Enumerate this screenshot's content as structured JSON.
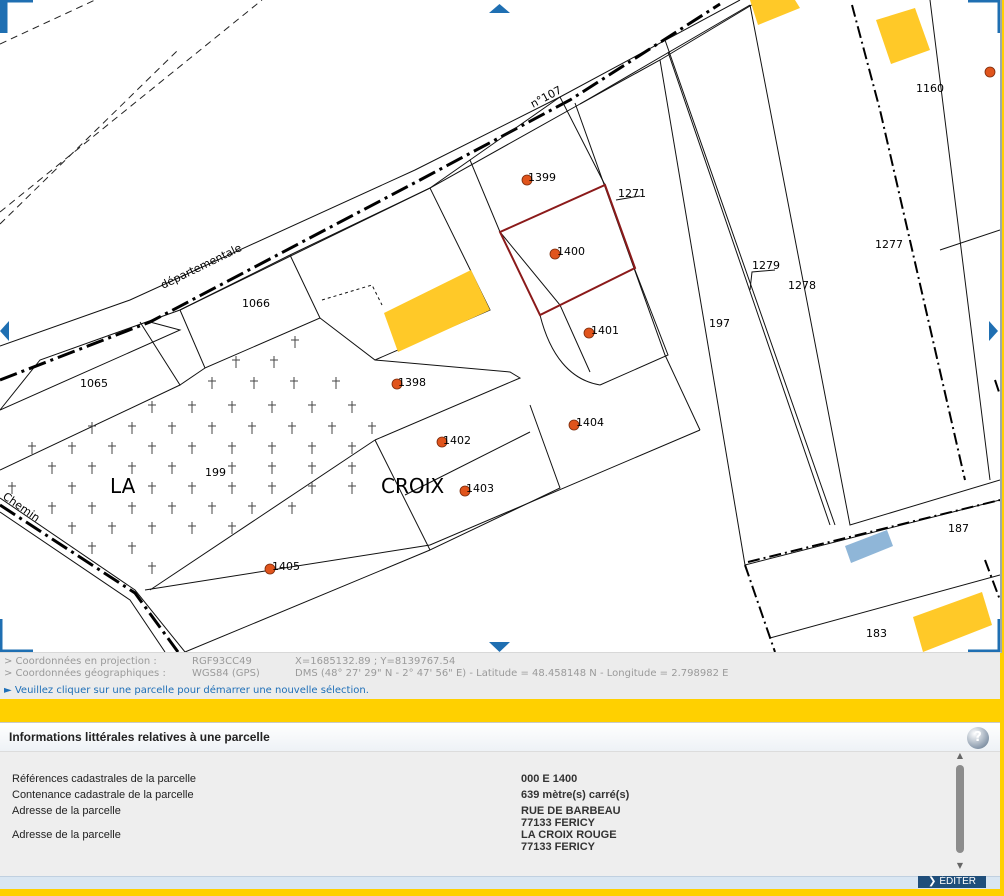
{
  "map": {
    "road_name": "départementale",
    "road_number": "n°107",
    "road_chemin": "Chemin",
    "place_la": "LA",
    "place_croix": "CROIX",
    "parcels": {
      "p1399": "1399",
      "p1271": "1271",
      "p1400": "1400",
      "p1401": "1401",
      "p1066": "1066",
      "p1065": "1065",
      "p1398": "1398",
      "p1402": "1402",
      "p1403": "1403",
      "p1404": "1404",
      "p199": "199",
      "p1405": "1405",
      "p197": "197",
      "p1279": "1279",
      "p1278": "1278",
      "p1277": "1277",
      "p1160": "1160",
      "p187": "187",
      "p183": "183"
    },
    "selected_parcel": "1400",
    "colors": {
      "building": "#ffc928",
      "water": "#8fb6d8",
      "selection": "#8b1a1a",
      "marker": "#e0541c",
      "nav_accent": "#1f6fb2"
    }
  },
  "coords": {
    "proj_label": "> Coordonnées en projection :",
    "proj_system": "RGF93CC49",
    "proj_value": "X=1685132.89 ; Y=8139767.54",
    "geo_label": "> Coordonnées géographiques :",
    "geo_system": "WGS84 (GPS)",
    "geo_value": "DMS (48° 27' 29\" N - 2° 47' 56\" E) - Latitude = 48.458148 N - Longitude = 2.798982 E",
    "hint": "► Veuillez cliquer sur une parcelle pour démarrer une nouvelle sélection."
  },
  "info": {
    "title": "Informations littérales relatives à une parcelle",
    "help_label": "?",
    "ref_label": "Références cadastrales de la parcelle",
    "ref_value": "000 E 1400",
    "area_label": "Contenance cadastrale de la parcelle",
    "area_value": "639 mètre(s) carré(s)",
    "addr1_label": "Adresse de la parcelle",
    "addr1_line1": "RUE DE BARBEAU",
    "addr1_line2": "77133 FERICY",
    "addr2_label": "Adresse de la parcelle",
    "addr2_line1": "LA CROIX ROUGE",
    "addr2_line2": "77133 FERICY",
    "edit_label": "ÉDITER"
  }
}
